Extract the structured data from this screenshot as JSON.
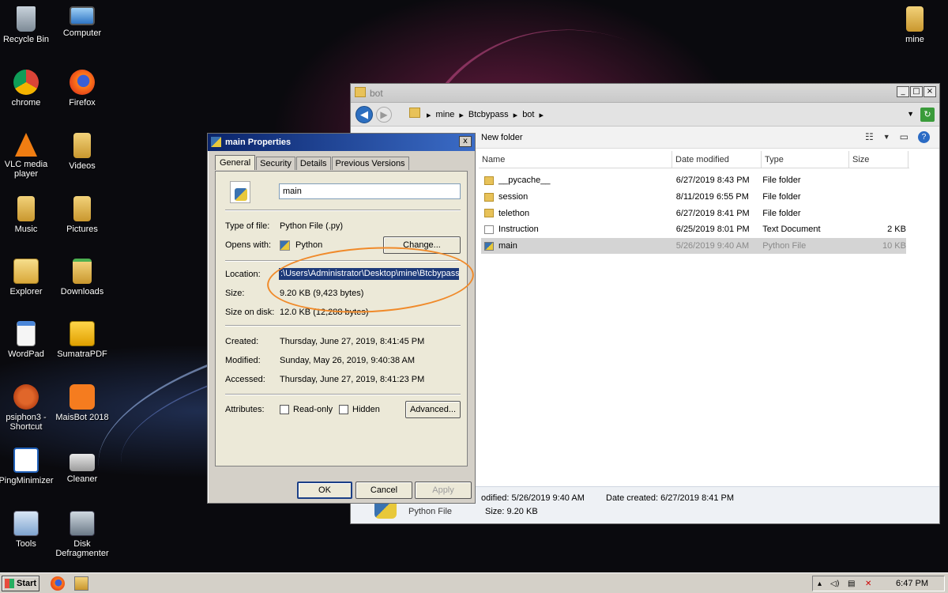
{
  "desktop": {
    "icons": [
      {
        "label": "Recycle Bin"
      },
      {
        "label": "Computer"
      },
      {
        "label": "chrome"
      },
      {
        "label": "Firefox"
      },
      {
        "label": "VLC media player"
      },
      {
        "label": "Videos"
      },
      {
        "label": "Music"
      },
      {
        "label": "Pictures"
      },
      {
        "label": "Explorer"
      },
      {
        "label": "Downloads"
      },
      {
        "label": "WordPad"
      },
      {
        "label": "SumatraPDF"
      },
      {
        "label": "psiphon3 - Shortcut"
      },
      {
        "label": "MaisBot 2018"
      },
      {
        "label": "PingMinimizer"
      },
      {
        "label": "Cleaner"
      },
      {
        "label": "Tools"
      },
      {
        "label": "Disk Defragmenter"
      },
      {
        "label": "mine"
      }
    ]
  },
  "explorer": {
    "title": "bot",
    "breadcrumb": [
      "mine",
      "Btcbypass",
      "bot"
    ],
    "new_folder": "New folder",
    "columns": [
      "Name",
      "Date modified",
      "Type",
      "Size"
    ],
    "files": [
      {
        "name": "__pycache__",
        "date": "6/27/2019 8:43 PM",
        "type": "File folder",
        "size": "",
        "icon": "folder-icon"
      },
      {
        "name": "session",
        "date": "8/11/2019 6:55 PM",
        "type": "File folder",
        "size": "",
        "icon": "folder-icon"
      },
      {
        "name": "telethon",
        "date": "6/27/2019 8:41 PM",
        "type": "File folder",
        "size": "",
        "icon": "folder-icon"
      },
      {
        "name": "Instruction",
        "date": "6/25/2019 8:01 PM",
        "type": "Text Document",
        "size": "2 KB",
        "icon": "text-document-icon"
      },
      {
        "name": "main",
        "date": "5/26/2019 9:40 AM",
        "type": "Python File",
        "size": "10 KB",
        "icon": "python-file-icon",
        "selected": true
      }
    ],
    "details": {
      "modified": "odified: 5/26/2019 9:40 AM",
      "created": "Date created: 6/27/2019 8:41 PM",
      "type": "Python File",
      "size": "Size: 9.20 KB"
    }
  },
  "properties": {
    "title": "main Properties",
    "close_glyph": "x",
    "tabs": [
      "General",
      "Security",
      "Details",
      "Previous Versions"
    ],
    "name_value": "main",
    "type_of_file_label": "Type of file:",
    "type_of_file": "Python File (.py)",
    "opens_with_label": "Opens with:",
    "opens_with": "Python",
    "change_button": "Change...",
    "location_label": "Location:",
    "location": ":\\Users\\Administrator\\Desktop\\mine\\Btcbypass\\bot",
    "size_label": "Size:",
    "size": "9.20 KB (9,423 bytes)",
    "size_on_disk_label": "Size on disk:",
    "size_on_disk": "12.0 KB (12,288 bytes)",
    "created_label": "Created:",
    "created": "Thursday, June 27, 2019, 8:41:45 PM",
    "modified_label": "Modified:",
    "modified": "Sunday, May 26, 2019, 9:40:38 AM",
    "accessed_label": "Accessed:",
    "accessed": "Thursday, June 27, 2019, 8:41:23 PM",
    "attributes_label": "Attributes:",
    "readonly_label": "Read-only",
    "hidden_label": "Hidden",
    "advanced_button": "Advanced...",
    "ok_button": "OK",
    "cancel_button": "Cancel",
    "apply_button": "Apply"
  },
  "taskbar": {
    "start_label": "Start",
    "clock": "6:47 PM"
  },
  "colors": {
    "selection": "#1d3a7a",
    "annotation_circle": "#f08a2a",
    "dialog_face": "#d4d0c8"
  }
}
